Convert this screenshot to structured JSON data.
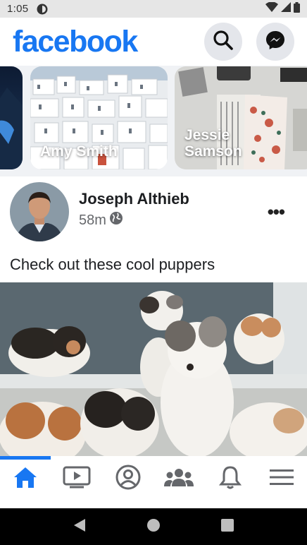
{
  "status_bar": {
    "time": "1:05"
  },
  "header": {
    "logo": "facebook",
    "search_icon": "search-icon",
    "messenger_icon": "messenger-icon"
  },
  "stories": [
    {
      "name": ""
    },
    {
      "name": "Amy Smith"
    },
    {
      "name": "Jessie Samson"
    }
  ],
  "post": {
    "author": "Joseph Althieb",
    "time": "58m",
    "privacy_icon": "globe-icon",
    "text": "Check out these cool puppers",
    "more_label": "•••"
  },
  "bottom_nav": {
    "items": [
      "home-icon",
      "watch-icon",
      "profile-icon",
      "groups-icon",
      "notifications-icon",
      "menu-icon"
    ],
    "active": 0
  },
  "colors": {
    "brand": "#1877f2",
    "text": "#1c1e21",
    "secondary": "#65676b",
    "button_bg": "#e4e6eb"
  }
}
